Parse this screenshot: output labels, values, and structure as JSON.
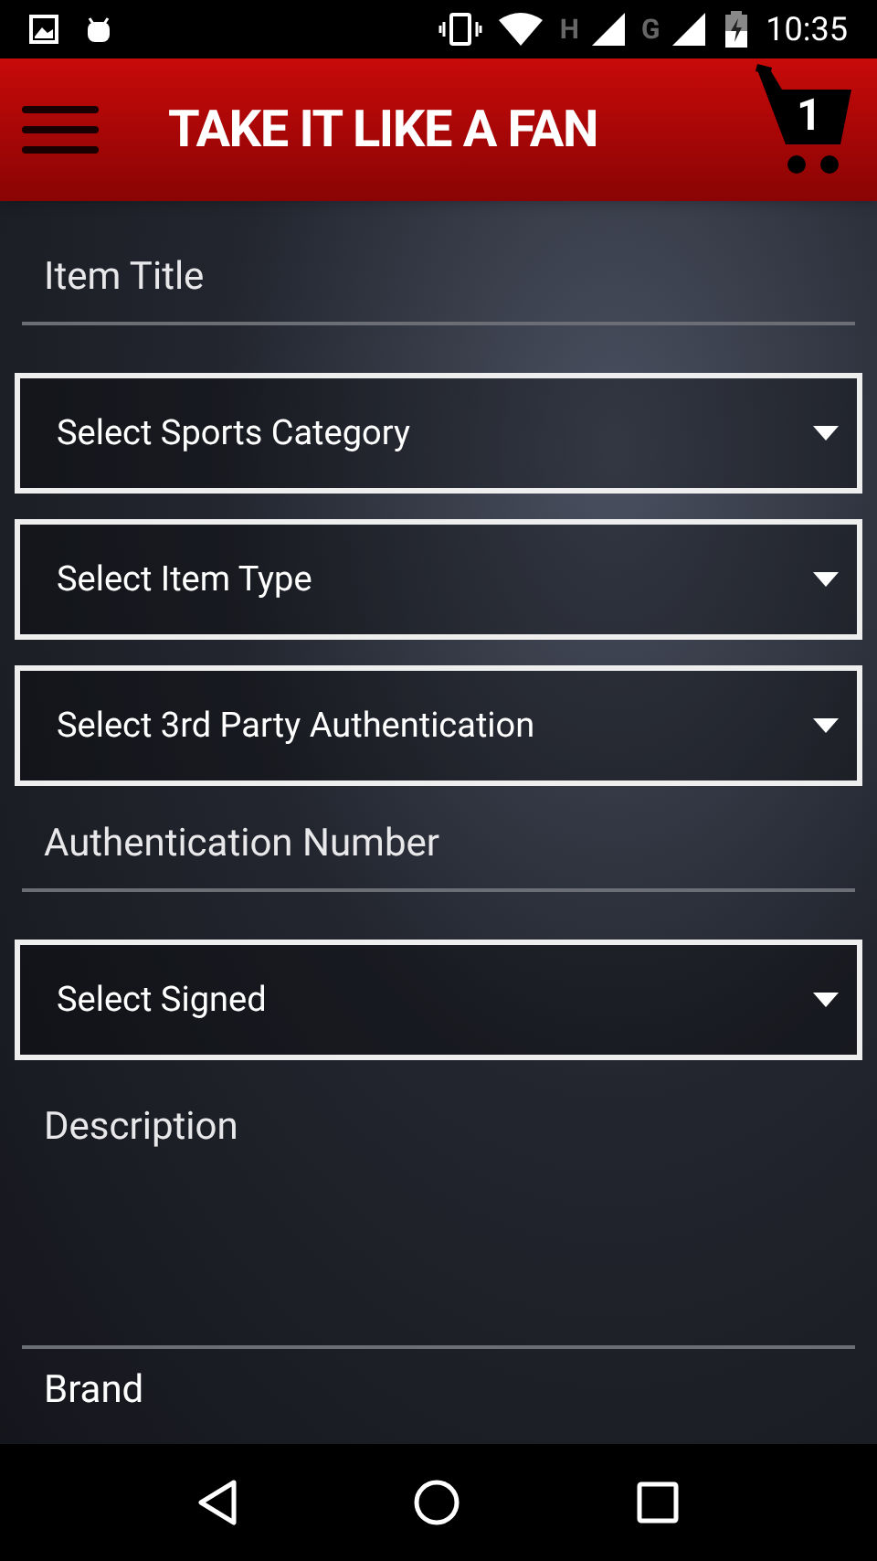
{
  "status_bar": {
    "time": "10:35",
    "network_labels": [
      "H",
      "G"
    ]
  },
  "app_bar": {
    "title": "TAKE IT LIKE A FAN",
    "cart_count": "1"
  },
  "form": [
    {
      "kind": "text",
      "placeholder": "Item Title"
    },
    {
      "kind": "select",
      "placeholder": "Select Sports Category"
    },
    {
      "kind": "select",
      "placeholder": "Select Item Type"
    },
    {
      "kind": "select",
      "placeholder": "Select 3rd Party Authentication"
    },
    {
      "kind": "text",
      "placeholder": "Authentication Number"
    },
    {
      "kind": "select",
      "placeholder": "Select Signed"
    },
    {
      "kind": "textarea",
      "placeholder": "Description"
    },
    {
      "kind": "label",
      "text": "Brand"
    }
  ]
}
